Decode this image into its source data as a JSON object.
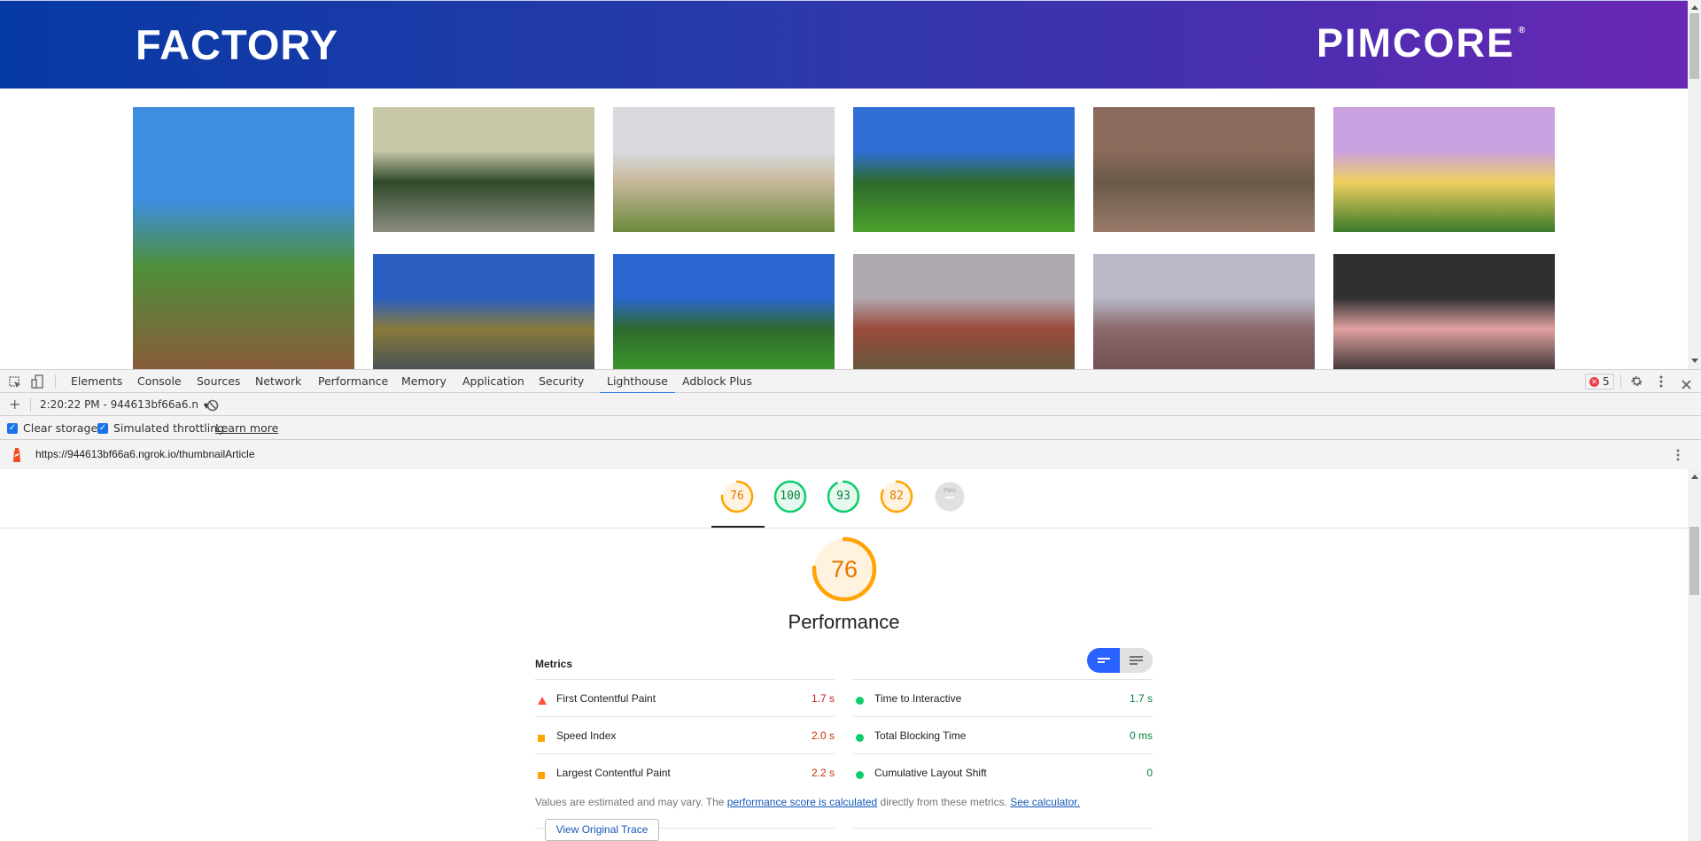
{
  "site": {
    "brand_left": "FACTORY",
    "brand_right": "PIMCORE",
    "brand_right_mark": "®",
    "header_gradient": [
      "#063aa5",
      "#6a27b5"
    ],
    "gallery": [
      {
        "name": "street-trees-photo",
        "colors": [
          "#3d8ee0",
          "#4f8f3a",
          "#8a5a3a"
        ]
      },
      {
        "name": "forest-valley-photo",
        "colors": [
          "#c8c8a8",
          "#2f4a2a",
          "#8c8c80"
        ]
      },
      {
        "name": "venice-sign-photo",
        "colors": [
          "#d8dade",
          "#c7b79a",
          "#6b8a3c"
        ]
      },
      {
        "name": "palm-park-photo",
        "colors": [
          "#2f6fd6",
          "#2d6a2d",
          "#4aa02c"
        ]
      },
      {
        "name": "canyon-rock-photo",
        "colors": [
          "#8a6a5a",
          "#6a5a48",
          "#9a7a6a"
        ]
      },
      {
        "name": "graffiti-mural-photo",
        "colors": [
          "#c9a0e0",
          "#f0d060",
          "#3a7a2a"
        ]
      },
      {
        "name": "lake-mountain-photo",
        "colors": [
          "#2a5ec0",
          "#8a7a3a",
          "#3a4a5a"
        ]
      },
      {
        "name": "palm-lawn-photo",
        "colors": [
          "#2a66d0",
          "#2e6a2e",
          "#3ea02a"
        ]
      },
      {
        "name": "grand-canyon-photo",
        "colors": [
          "#b0a8b0",
          "#9a4a3a",
          "#5a5a40"
        ]
      },
      {
        "name": "canyon-river-photo",
        "colors": [
          "#b8b8c8",
          "#8a6a6a",
          "#6a4a4a"
        ]
      },
      {
        "name": "dark-surface-photo",
        "colors": [
          "#303030",
          "#e0a0a0",
          "#202020"
        ]
      }
    ]
  },
  "devtools": {
    "tabs": [
      {
        "label": "Elements",
        "active": false
      },
      {
        "label": "Console",
        "active": false
      },
      {
        "label": "Sources",
        "active": false
      },
      {
        "label": "Network",
        "active": false
      },
      {
        "label": "Performance",
        "active": false
      },
      {
        "label": "Memory",
        "active": false
      },
      {
        "label": "Application",
        "active": false
      },
      {
        "label": "Security",
        "active": false
      },
      {
        "label": "Lighthouse",
        "active": true
      },
      {
        "label": "Adblock Plus",
        "active": false
      }
    ],
    "error_count": "5",
    "report_selector": "2:20:22 PM - 944613bf66a6.n",
    "options": {
      "clear_storage": {
        "label": "Clear storage",
        "checked": true
      },
      "simulated_throttling": {
        "label": "Simulated throttling",
        "checked": true
      },
      "learn_more": "Learn more"
    },
    "url": "https://944613bf66a6.ngrok.io/thumbnailArticle"
  },
  "lighthouse": {
    "colors": {
      "average": "#ffa400",
      "pass": "#0cce6b",
      "fail": "#ff4e42",
      "na": "#e0e0e0"
    },
    "category_gauges": [
      {
        "score": "76",
        "fraction": 0.76,
        "status": "average",
        "category": "performance"
      },
      {
        "score": "100",
        "fraction": 1.0,
        "status": "pass",
        "category": "accessibility"
      },
      {
        "score": "93",
        "fraction": 0.93,
        "status": "pass",
        "category": "best-practices"
      },
      {
        "score": "82",
        "fraction": 0.82,
        "status": "average",
        "category": "seo"
      },
      {
        "score": "–",
        "fraction": 0,
        "status": "na",
        "category": "pwa",
        "badge": "PWA"
      }
    ],
    "performance": {
      "score": "76",
      "fraction": 0.76,
      "title": "Performance",
      "metrics_title": "Metrics",
      "metrics_left": [
        {
          "label": "First Contentful Paint",
          "value": "1.7 s",
          "status": "fail"
        },
        {
          "label": "Speed Index",
          "value": "2.0 s",
          "status": "average"
        },
        {
          "label": "Largest Contentful Paint",
          "value": "2.2 s",
          "status": "average"
        }
      ],
      "metrics_right": [
        {
          "label": "Time to Interactive",
          "value": "1.7 s",
          "status": "pass"
        },
        {
          "label": "Total Blocking Time",
          "value": "0 ms",
          "status": "pass"
        },
        {
          "label": "Cumulative Layout Shift",
          "value": "0",
          "status": "pass"
        }
      ],
      "note_prefix": "Values are estimated and may vary. The ",
      "note_link": "performance score is calculated",
      "note_middle": " directly from these metrics. ",
      "note_link2": "See calculator.",
      "view_trace": "View Original Trace"
    }
  }
}
